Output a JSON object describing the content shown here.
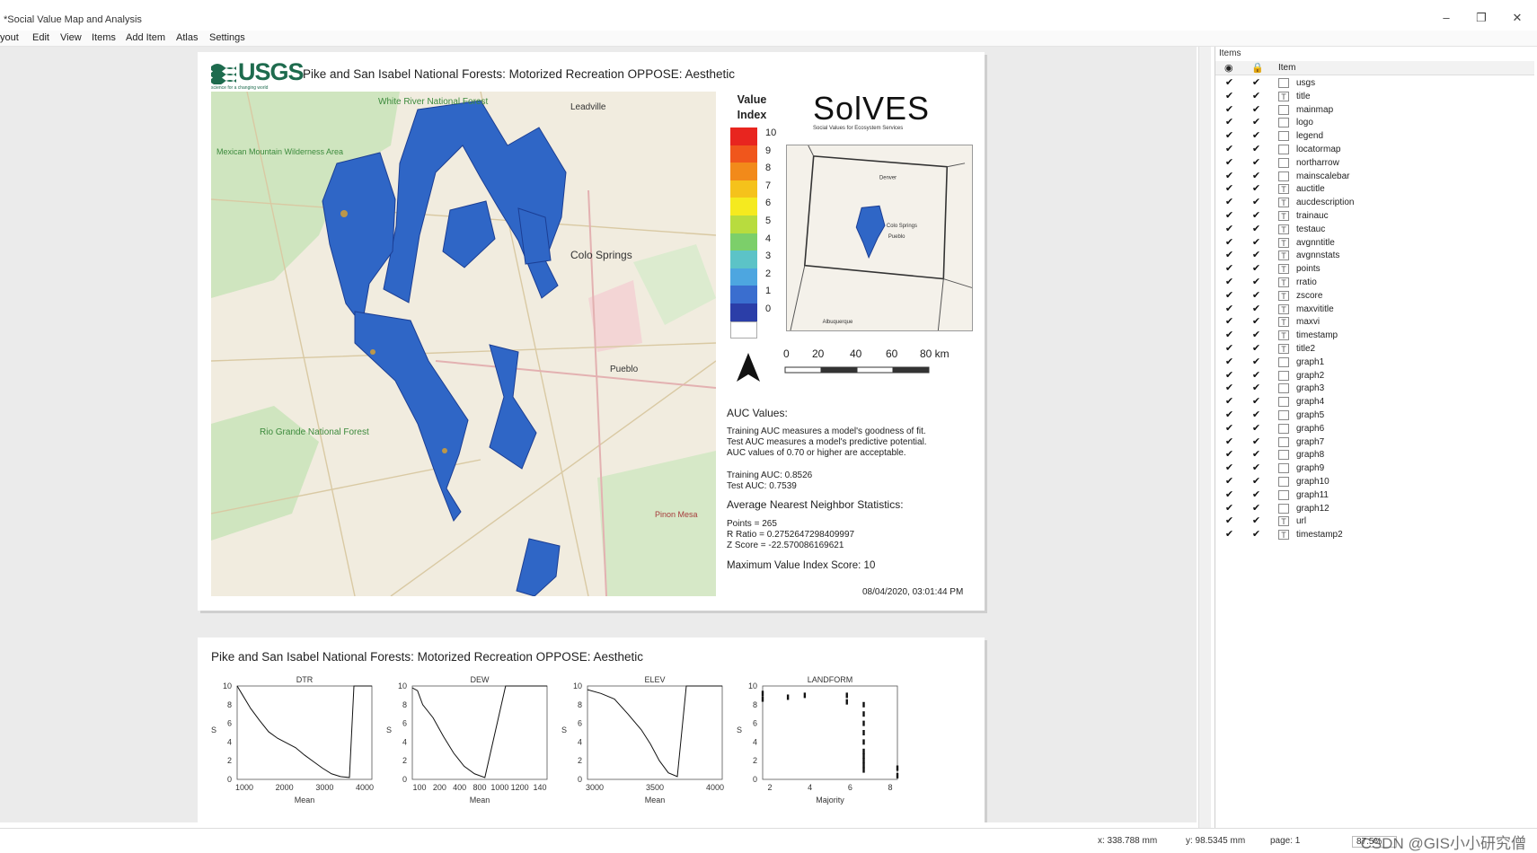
{
  "window": {
    "title": "*Social Value Map and Analysis",
    "minimize": "–",
    "maximize": "❐",
    "close": "✕"
  },
  "menu": [
    "yout",
    "Edit",
    "View",
    "Items",
    "Add Item",
    "Atlas",
    "Settings"
  ],
  "page1": {
    "logo": {
      "text": "USGS",
      "tagline": "science for a changing world"
    },
    "title": "Pike and San Isabel National Forests: Motorized Recreation OPPOSE: Aesthetic",
    "map_labels": [
      "White River National Forest",
      "Leadville",
      "Colo Springs",
      "Pueblo",
      "Rio Grande National Forest",
      "Pinon Mesa",
      "Mexican Mountain Wilderness Area"
    ],
    "legend": {
      "title_line1": "Value",
      "title_line2": "Index",
      "colors": [
        "#e8251f",
        "#f0561c",
        "#f28a1a",
        "#f5c21b",
        "#f5ea1f",
        "#b8dc3e",
        "#7ccf6a",
        "#5cc3c7",
        "#4da6e0",
        "#3a6ecf",
        "#2b3ea8",
        "#ffffff"
      ],
      "labels": [
        "10",
        "9",
        "8",
        "7",
        "6",
        "5",
        "4",
        "3",
        "2",
        "1",
        "0"
      ]
    },
    "solves": {
      "text": "SolVES",
      "subtitle": "Social Values for Ecosystem Services"
    },
    "locator_labels": [
      "Denver",
      "Colo Springs",
      "Pueblo",
      "Albuquerque"
    ],
    "scalebar": {
      "labels": [
        "0",
        "20",
        "40",
        "60",
        "80 km"
      ]
    },
    "auc": {
      "title": "AUC Values:",
      "desc": [
        "Training AUC measures a model's goodness of fit.",
        "Test AUC measures a model's predictive potential.",
        "AUC values of 0.70 or higher are acceptable."
      ],
      "training": "Training AUC: 0.8526",
      "test": "Test AUC: 0.7539"
    },
    "nn": {
      "title": "Average Nearest Neighbor Statistics:",
      "points": "Points = 265",
      "ratio": "R Ratio = 0.2752647298409997",
      "zscore": "Z Score = -22.570086169621"
    },
    "max": "Maximum Value Index Score: 10",
    "timestamp": "08/04/2020, 03:01:44 PM"
  },
  "page2": {
    "title": "Pike and San Isabel National Forests: Motorized Recreation OPPOSE: Aesthetic"
  },
  "chart_data": [
    {
      "type": "line",
      "title": "DTR",
      "xlabel": "Mean",
      "ylabel": "S",
      "ylim": [
        0,
        10
      ],
      "xticks": [
        "1000",
        "2000",
        "3000",
        "4000"
      ],
      "yticks": [
        "0",
        "2",
        "4",
        "6",
        "8",
        "10"
      ],
      "x": [
        1000,
        1100,
        1300,
        1500,
        1700,
        1900,
        2100,
        2300,
        2500,
        2700,
        2900,
        3100,
        3300,
        3500,
        3600,
        3700,
        4000
      ],
      "values": [
        10,
        9.2,
        7.6,
        6.3,
        5.1,
        4.4,
        3.9,
        3.4,
        2.6,
        1.9,
        1.2,
        0.6,
        0.3,
        0.2,
        10,
        10,
        10
      ]
    },
    {
      "type": "line",
      "title": "DEW",
      "xlabel": "Mean",
      "ylabel": "S",
      "ylim": [
        0,
        10
      ],
      "xticks": [
        "100",
        "200",
        "400",
        "800",
        "1000",
        "1200",
        "140"
      ],
      "yticks": [
        "0",
        "2",
        "4",
        "6",
        "8",
        "10"
      ],
      "x": [
        100,
        150,
        200,
        300,
        400,
        500,
        600,
        700,
        800,
        1000,
        1200,
        1400
      ],
      "values": [
        9.8,
        9.5,
        8,
        6.6,
        4.6,
        2.8,
        1.4,
        0.6,
        0.2,
        10,
        10,
        10
      ]
    },
    {
      "type": "line",
      "title": "ELEV",
      "xlabel": "Mean",
      "ylabel": "S",
      "ylim": [
        0,
        10
      ],
      "xticks": [
        "3000",
        "3500",
        "4000"
      ],
      "yticks": [
        "0",
        "2",
        "4",
        "6",
        "8",
        "10"
      ],
      "x": [
        2700,
        2850,
        3000,
        3150,
        3300,
        3400,
        3500,
        3600,
        3700,
        3800,
        4000,
        4200
      ],
      "values": [
        9.6,
        9.2,
        8.6,
        7,
        5.3,
        3.8,
        2,
        0.7,
        0.3,
        10,
        10,
        10
      ]
    },
    {
      "type": "scatter",
      "title": "LANDFORM",
      "xlabel": "Majority",
      "ylabel": "S",
      "ylim": [
        0,
        10
      ],
      "xticks": [
        "2",
        "4",
        "6",
        "8"
      ],
      "yticks": [
        "0",
        "2",
        "4",
        "6",
        "8",
        "10"
      ],
      "x": [
        0.5,
        0.5,
        2,
        3,
        5.5,
        5.5,
        6.5,
        6.5,
        6.5,
        6.5,
        6.5,
        6.5,
        6.5,
        6.5,
        6.5,
        6.5,
        8.5,
        8.5
      ],
      "values": [
        9.2,
        8.6,
        8.8,
        9,
        9,
        8.3,
        8,
        7,
        6,
        5,
        4,
        3,
        2.5,
        2,
        1.5,
        1,
        1.2,
        0.4
      ]
    }
  ],
  "panel": {
    "title": "Items",
    "column": "Item",
    "items": [
      "usgs",
      "title",
      "mainmap",
      "logo",
      "legend",
      "locatormap",
      "northarrow",
      "mainscalebar",
      "auctitle",
      "aucdescription",
      "trainauc",
      "testauc",
      "avgnntitle",
      "avgnnstats",
      "points",
      "rratio",
      "zscore",
      "maxvititle",
      "maxvi",
      "timestamp",
      "title2",
      "graph1",
      "graph2",
      "graph3",
      "graph4",
      "graph5",
      "graph6",
      "graph7",
      "graph8",
      "graph9",
      "graph10",
      "graph11",
      "graph12",
      "url",
      "timestamp2"
    ],
    "checkmark": "✔"
  },
  "status": {
    "x": "x: 338.788 mm",
    "y": "y: 98.5345 mm",
    "page": "page: 1",
    "zoom": "87.5%"
  },
  "watermark": "CSDN @GIS小小研究僧"
}
